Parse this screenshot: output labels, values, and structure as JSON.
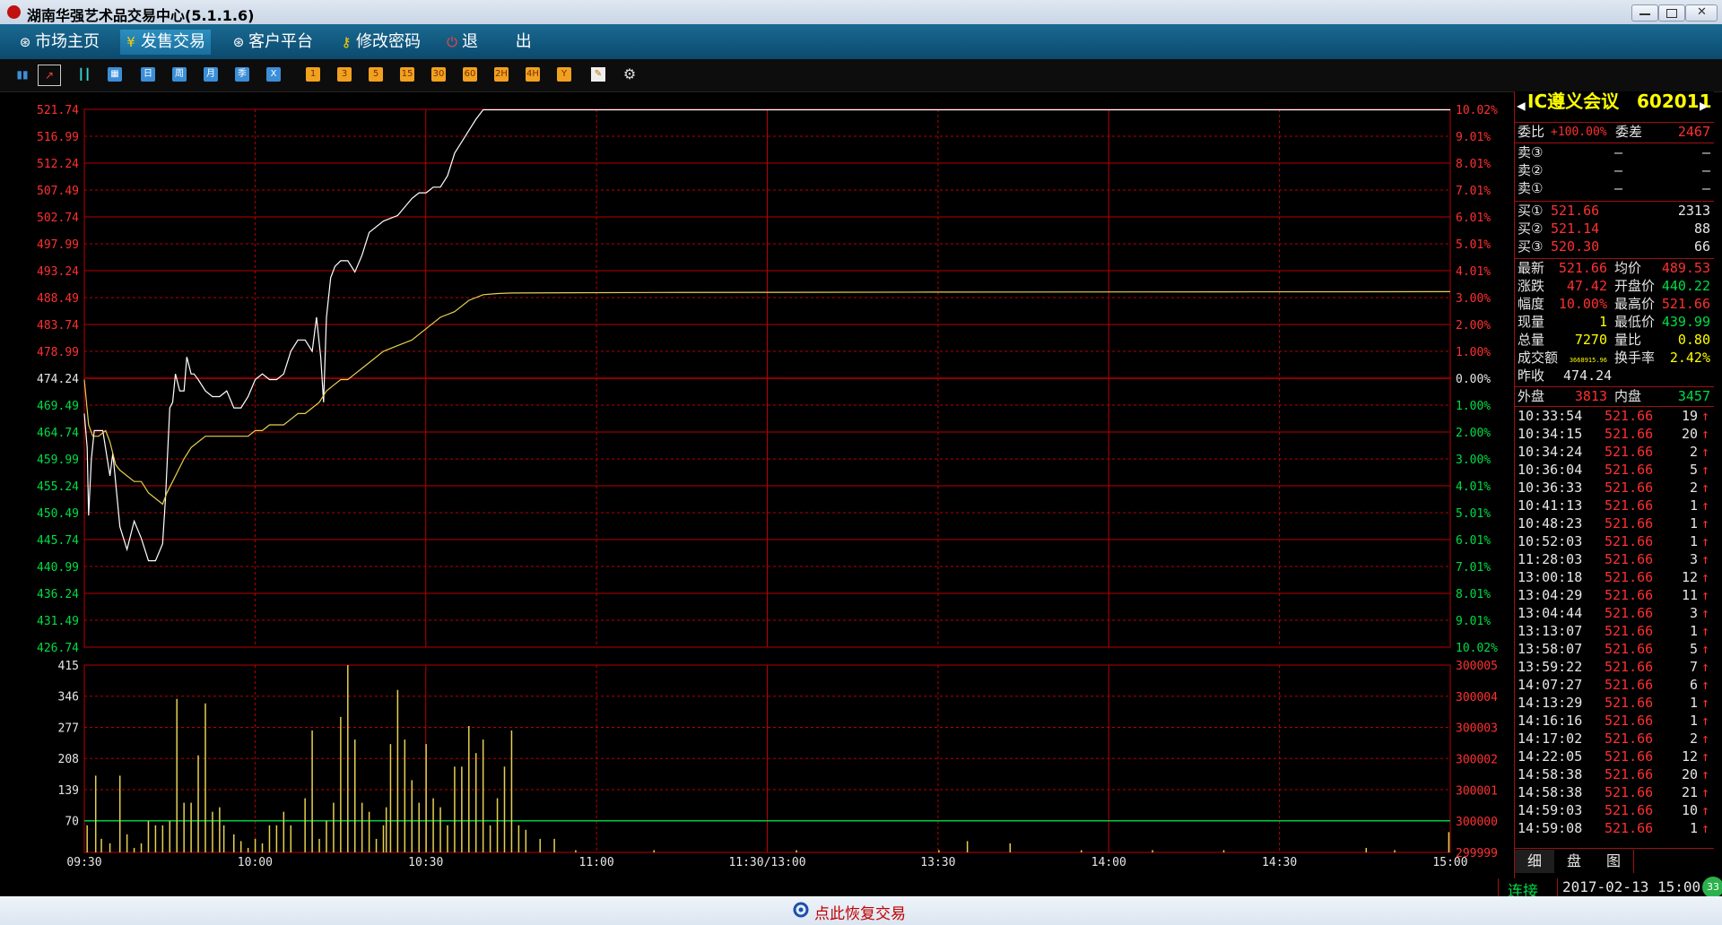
{
  "window": {
    "title": "湖南华强艺术品交易中心(5.1.1.6)"
  },
  "menu": {
    "items": [
      {
        "label": "市场主页",
        "icon": "globe-icon"
      },
      {
        "label": "发售交易",
        "icon": "yen-icon",
        "active": true
      },
      {
        "label": "客户平台",
        "icon": "globe-icon"
      },
      {
        "label": "修改密码",
        "icon": "key-icon"
      },
      {
        "label": "退 出",
        "icon": "power-icon"
      }
    ]
  },
  "toolbar": {
    "icons": [
      "bar-chart-icon",
      "line-chart-icon",
      "candlestick-icon"
    ],
    "period_buttons": [
      "日",
      "周",
      "月",
      "季",
      "X"
    ],
    "minute_buttons": [
      "1",
      "3",
      "5",
      "15",
      "30",
      "60",
      "2H",
      "4H",
      "Y"
    ],
    "tool_icons": [
      "pencil-icon",
      "gear-icon"
    ]
  },
  "chart_data": {
    "type": "line",
    "price": {
      "ticks": [
        "521.74",
        "516.99",
        "512.24",
        "507.49",
        "502.74",
        "497.99",
        "493.24",
        "488.49",
        "483.74",
        "478.99",
        "474.24",
        "469.49",
        "464.74",
        "459.99",
        "455.24",
        "450.49",
        "445.74",
        "440.99",
        "436.24",
        "431.49",
        "426.74"
      ],
      "pct": [
        "10.02%",
        "9.01%",
        "8.01%",
        "7.01%",
        "6.01%",
        "5.01%",
        "4.01%",
        "3.00%",
        "2.00%",
        "1.00%",
        "0.00%",
        "1.00%",
        "2.00%",
        "3.00%",
        "4.01%",
        "5.01%",
        "6.01%",
        "7.01%",
        "8.01%",
        "9.01%",
        "10.02%"
      ],
      "ylim": [
        426.74,
        521.74
      ],
      "prev_close": 474.24
    },
    "x_labels": [
      "09:30",
      "10:00",
      "10:30",
      "11:00",
      "11:30/13:00",
      "13:30",
      "14:00",
      "14:30",
      "15:00"
    ],
    "series": [
      {
        "color": "#ffffff",
        "points": [
          [
            0,
            468
          ],
          [
            2,
            462
          ],
          [
            3,
            450
          ],
          [
            5,
            460
          ],
          [
            7,
            465
          ],
          [
            10,
            465
          ],
          [
            13,
            465
          ],
          [
            18,
            457
          ],
          [
            20,
            461
          ],
          [
            25,
            448
          ],
          [
            30,
            444
          ],
          [
            35,
            449
          ],
          [
            40,
            446
          ],
          [
            45,
            442
          ],
          [
            50,
            442
          ],
          [
            55,
            445
          ],
          [
            57,
            453
          ],
          [
            60,
            469
          ],
          [
            62,
            470
          ],
          [
            64,
            475
          ],
          [
            67,
            472
          ],
          [
            70,
            472
          ],
          [
            72,
            478
          ],
          [
            75,
            475
          ],
          [
            77,
            475
          ],
          [
            80,
            474
          ],
          [
            85,
            472
          ],
          [
            90,
            471
          ],
          [
            95,
            471
          ],
          [
            100,
            472
          ],
          [
            105,
            469
          ],
          [
            110,
            469
          ],
          [
            115,
            471
          ],
          [
            120,
            474
          ],
          [
            125,
            475
          ],
          [
            130,
            474
          ],
          [
            135,
            474
          ],
          [
            140,
            475
          ],
          [
            145,
            479
          ],
          [
            150,
            481
          ],
          [
            155,
            481
          ],
          [
            160,
            479
          ],
          [
            163,
            485
          ],
          [
            166,
            478
          ],
          [
            168,
            470
          ],
          [
            170,
            485
          ],
          [
            173,
            492
          ],
          [
            176,
            494
          ],
          [
            180,
            495
          ],
          [
            185,
            495
          ],
          [
            190,
            493
          ],
          [
            195,
            496
          ],
          [
            200,
            500
          ],
          [
            210,
            502
          ],
          [
            220,
            503
          ],
          [
            230,
            506
          ],
          [
            235,
            507
          ],
          [
            240,
            507
          ],
          [
            245,
            508
          ],
          [
            250,
            508
          ],
          [
            255,
            510
          ],
          [
            260,
            514
          ],
          [
            265,
            516
          ],
          [
            270,
            518
          ],
          [
            275,
            520
          ],
          [
            280,
            521.66
          ],
          [
            290,
            521.66
          ],
          [
            400,
            521.66
          ],
          [
            600,
            521.66
          ],
          [
            800,
            521.66
          ],
          [
            959,
            521.66
          ]
        ]
      },
      {
        "color": "#e6d050",
        "points": [
          [
            0,
            474
          ],
          [
            3,
            466
          ],
          [
            6,
            464
          ],
          [
            10,
            464
          ],
          [
            15,
            465
          ],
          [
            18,
            463
          ],
          [
            22,
            459
          ],
          [
            25,
            458
          ],
          [
            30,
            457
          ],
          [
            35,
            456
          ],
          [
            40,
            456
          ],
          [
            45,
            454
          ],
          [
            50,
            453
          ],
          [
            55,
            452
          ],
          [
            58,
            454
          ],
          [
            62,
            456
          ],
          [
            66,
            458
          ],
          [
            70,
            460
          ],
          [
            75,
            462
          ],
          [
            80,
            463
          ],
          [
            85,
            464
          ],
          [
            90,
            464
          ],
          [
            95,
            464
          ],
          [
            100,
            464
          ],
          [
            105,
            464
          ],
          [
            110,
            464
          ],
          [
            115,
            464
          ],
          [
            120,
            465
          ],
          [
            125,
            465
          ],
          [
            130,
            466
          ],
          [
            135,
            466
          ],
          [
            140,
            466
          ],
          [
            145,
            467
          ],
          [
            150,
            468
          ],
          [
            155,
            468
          ],
          [
            160,
            469
          ],
          [
            165,
            470
          ],
          [
            170,
            472
          ],
          [
            175,
            473
          ],
          [
            180,
            474
          ],
          [
            185,
            474
          ],
          [
            190,
            475
          ],
          [
            195,
            476
          ],
          [
            200,
            477
          ],
          [
            210,
            479
          ],
          [
            220,
            480
          ],
          [
            230,
            481
          ],
          [
            240,
            483
          ],
          [
            250,
            485
          ],
          [
            260,
            486
          ],
          [
            270,
            488
          ],
          [
            280,
            489
          ],
          [
            290,
            489.2
          ],
          [
            300,
            489.3
          ],
          [
            400,
            489.4
          ],
          [
            600,
            489.45
          ],
          [
            800,
            489.5
          ],
          [
            959,
            489.53
          ]
        ]
      }
    ],
    "volume": {
      "ticks": [
        "415",
        "346",
        "277",
        "208",
        "139",
        "70"
      ],
      "right_ticks": [
        "300005",
        "300004",
        "300003",
        "300002",
        "300001",
        "300000",
        "299999"
      ],
      "ylim": [
        0,
        415
      ],
      "bars": [
        [
          2,
          60
        ],
        [
          8,
          170
        ],
        [
          12,
          30
        ],
        [
          18,
          20
        ],
        [
          25,
          170
        ],
        [
          30,
          40
        ],
        [
          35,
          10
        ],
        [
          40,
          20
        ],
        [
          45,
          70
        ],
        [
          50,
          60
        ],
        [
          55,
          60
        ],
        [
          60,
          70
        ],
        [
          65,
          340
        ],
        [
          70,
          110
        ],
        [
          75,
          110
        ],
        [
          80,
          215
        ],
        [
          85,
          330
        ],
        [
          90,
          90
        ],
        [
          95,
          100
        ],
        [
          98,
          60
        ],
        [
          105,
          40
        ],
        [
          110,
          25
        ],
        [
          115,
          10
        ],
        [
          120,
          30
        ],
        [
          125,
          20
        ],
        [
          130,
          60
        ],
        [
          135,
          60
        ],
        [
          140,
          90
        ],
        [
          145,
          60
        ],
        [
          155,
          120
        ],
        [
          160,
          270
        ],
        [
          165,
          30
        ],
        [
          170,
          70
        ],
        [
          175,
          110
        ],
        [
          180,
          300
        ],
        [
          185,
          415
        ],
        [
          190,
          250
        ],
        [
          195,
          110
        ],
        [
          200,
          90
        ],
        [
          205,
          30
        ],
        [
          210,
          60
        ],
        [
          212,
          100
        ],
        [
          215,
          240
        ],
        [
          220,
          360
        ],
        [
          225,
          250
        ],
        [
          230,
          160
        ],
        [
          235,
          110
        ],
        [
          240,
          240
        ],
        [
          245,
          120
        ],
        [
          250,
          100
        ],
        [
          255,
          60
        ],
        [
          260,
          190
        ],
        [
          265,
          190
        ],
        [
          270,
          280
        ],
        [
          275,
          220
        ],
        [
          280,
          250
        ],
        [
          285,
          60
        ],
        [
          290,
          120
        ],
        [
          295,
          190
        ],
        [
          300,
          270
        ],
        [
          305,
          60
        ],
        [
          310,
          50
        ],
        [
          320,
          30
        ],
        [
          330,
          30
        ],
        [
          345,
          5
        ],
        [
          400,
          5
        ],
        [
          500,
          5
        ],
        [
          600,
          5
        ],
        [
          620,
          25
        ],
        [
          650,
          20
        ],
        [
          700,
          5
        ],
        [
          750,
          5
        ],
        [
          800,
          5
        ],
        [
          900,
          10
        ],
        [
          920,
          5
        ],
        [
          958,
          45
        ]
      ]
    }
  },
  "quote": {
    "name": "IC遵义会议",
    "code": "602011",
    "weibi_label": "委比",
    "weibi": "+100.00%",
    "weicha_label": "委差",
    "weicha": "2467",
    "sells": [
      {
        "label": "卖③",
        "price": "—",
        "vol": "—"
      },
      {
        "label": "卖②",
        "price": "—",
        "vol": "—"
      },
      {
        "label": "卖①",
        "price": "—",
        "vol": "—"
      }
    ],
    "buys": [
      {
        "label": "买①",
        "price": "521.66",
        "vol": "2313"
      },
      {
        "label": "买②",
        "price": "521.14",
        "vol": "88"
      },
      {
        "label": "买③",
        "price": "520.30",
        "vol": "66"
      }
    ],
    "stats": [
      {
        "l1": "最新",
        "v1": "521.66",
        "l2": "均价",
        "v2": "489.53",
        "c1": "#ff3030",
        "c2": "#ff3030"
      },
      {
        "l1": "涨跌",
        "v1": "47.42",
        "l2": "开盘价",
        "v2": "440.22",
        "c1": "#ff3030",
        "c2": "#00dd44"
      },
      {
        "l1": "幅度",
        "v1": "10.00%",
        "l2": "最高价",
        "v2": "521.66",
        "c1": "#ff3030",
        "c2": "#ff3030"
      },
      {
        "l1": "现量",
        "v1": "1",
        "l2": "最低价",
        "v2": "439.99",
        "c1": "#ffff00",
        "c2": "#00dd44"
      },
      {
        "l1": "总量",
        "v1": "7270",
        "l2": "量比",
        "v2": "0.80",
        "c1": "#ffff00",
        "c2": "#ffff00"
      },
      {
        "l1": "成交额",
        "v1": "3668915.96",
        "l2": "换手率",
        "v2": "2.42%",
        "c1": "#ffff00",
        "c2": "#ffff00"
      },
      {
        "l1": "昨收",
        "v1": "474.24",
        "l2": "",
        "v2": "",
        "c1": "#e6e6e6",
        "c2": "#e6e6e6"
      }
    ],
    "outer_label": "外盘",
    "outer": "3813",
    "inner_label": "内盘",
    "inner": "3457",
    "ticks": [
      [
        "10:33:54",
        "521.66",
        "19"
      ],
      [
        "10:34:15",
        "521.66",
        "20"
      ],
      [
        "10:34:24",
        "521.66",
        "2"
      ],
      [
        "10:36:04",
        "521.66",
        "5"
      ],
      [
        "10:36:33",
        "521.66",
        "2"
      ],
      [
        "10:41:13",
        "521.66",
        "1"
      ],
      [
        "10:48:23",
        "521.66",
        "1"
      ],
      [
        "10:52:03",
        "521.66",
        "1"
      ],
      [
        "11:28:03",
        "521.66",
        "3"
      ],
      [
        "13:00:18",
        "521.66",
        "12"
      ],
      [
        "13:04:29",
        "521.66",
        "11"
      ],
      [
        "13:04:44",
        "521.66",
        "3"
      ],
      [
        "13:13:07",
        "521.66",
        "1"
      ],
      [
        "13:58:07",
        "521.66",
        "5"
      ],
      [
        "13:59:22",
        "521.66",
        "7"
      ],
      [
        "14:07:27",
        "521.66",
        "6"
      ],
      [
        "14:13:29",
        "521.66",
        "1"
      ],
      [
        "14:16:16",
        "521.66",
        "1"
      ],
      [
        "14:17:02",
        "521.66",
        "2"
      ],
      [
        "14:22:05",
        "521.66",
        "12"
      ],
      [
        "14:58:38",
        "521.66",
        "20"
      ],
      [
        "14:58:38",
        "521.66",
        "21"
      ],
      [
        "14:59:03",
        "521.66",
        "10"
      ],
      [
        "14:59:08",
        "521.66",
        "1"
      ]
    ],
    "tabs": [
      "细",
      "盘",
      "图"
    ]
  },
  "status": {
    "connection": "连接",
    "datetime": "2017-02-13  15:00",
    "badge": "33"
  },
  "bottom": {
    "restore": "点此恢复交易"
  }
}
